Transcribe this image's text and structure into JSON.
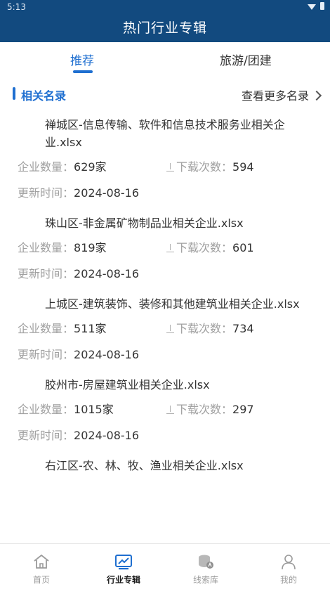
{
  "status": {
    "time": "5:13"
  },
  "header": {
    "title": "热门行业专辑"
  },
  "tabs": [
    {
      "label": "推荐",
      "active": true
    },
    {
      "label": "旅游/团建",
      "active": false
    }
  ],
  "section": {
    "title": "相关名录",
    "more": "查看更多名录"
  },
  "labels": {
    "count": "企业数量：",
    "downloads": "下载次数：",
    "updated": "更新时间："
  },
  "items": [
    {
      "file": "禅城区-信息传输、软件和信息技术服务业相关企业.xlsx",
      "count": "629家",
      "downloads": "594",
      "updated": "2024-08-16"
    },
    {
      "file": "珠山区-非金属矿物制品业相关企业.xlsx",
      "count": "819家",
      "downloads": "601",
      "updated": "2024-08-16"
    },
    {
      "file": "上城区-建筑装饰、装修和其他建筑业相关企业.xlsx",
      "count": "511家",
      "downloads": "734",
      "updated": "2024-08-16"
    },
    {
      "file": "胶州市-房屋建筑业相关企业.xlsx",
      "count": "1015家",
      "downloads": "297",
      "updated": "2024-08-16"
    },
    {
      "file": "右江区-农、林、牧、渔业相关企业.xlsx",
      "count": "",
      "downloads": "",
      "updated": ""
    }
  ],
  "nav": [
    {
      "label": "首页",
      "icon": "home-icon",
      "active": false
    },
    {
      "label": "行业专辑",
      "icon": "chart-icon",
      "active": true
    },
    {
      "label": "线索库",
      "icon": "database-icon",
      "active": false
    },
    {
      "label": "我的",
      "icon": "user-icon",
      "active": false
    }
  ],
  "colors": {
    "brand": "#124a7f",
    "accent": "#1f6fd0"
  }
}
